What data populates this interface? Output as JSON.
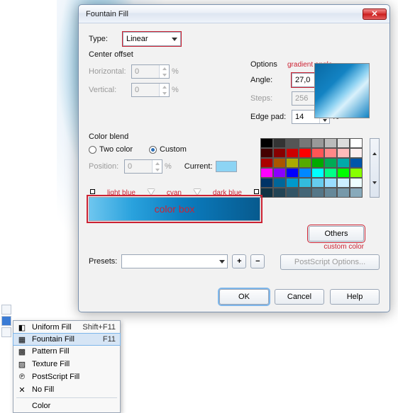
{
  "dialog": {
    "title": "Fountain Fill",
    "type_label": "Type:",
    "type_value": "Linear",
    "center_offset_label": "Center offset",
    "horizontal_label": "Horizontal:",
    "horizontal_value": "0",
    "vertical_label": "Vertical:",
    "vertical_value": "0",
    "options_label": "Options",
    "angle_label": "Angle:",
    "angle_value": "27,0",
    "steps_label": "Steps:",
    "steps_value": "256",
    "edgepad_label": "Edge pad:",
    "edgepad_value": "14",
    "percent": "%",
    "colorblend_label": "Color blend",
    "twocolor_label": "Two color",
    "custom_label": "Custom",
    "position_label": "Position:",
    "position_value": "0",
    "current_label": "Current:",
    "others_label": "Others",
    "presets_label": "Presets:",
    "postscript_label": "PostScript Options...",
    "ok": "OK",
    "cancel": "Cancel",
    "help": "Help"
  },
  "annotations": {
    "gradient_angle": "gradient angle",
    "light_blue": "light blue",
    "cyan": "cyan",
    "dark_blue": "dark blue",
    "color_box": "color box",
    "custom_color": "custom color"
  },
  "swatches": [
    [
      "#000",
      "#333",
      "#555",
      "#777",
      "#999",
      "#bbb",
      "#ddd",
      "#fff"
    ],
    [
      "#400",
      "#800",
      "#c00",
      "#f00",
      "#f55",
      "#f88",
      "#fbb",
      "#fee"
    ],
    [
      "#a00",
      "#a50",
      "#aa0",
      "#5a0",
      "#0a0",
      "#0a5",
      "#0aa",
      "#05a"
    ],
    [
      "#f0f",
      "#80f",
      "#00f",
      "#08f",
      "#0ff",
      "#0f8",
      "#0f0",
      "#8f0"
    ],
    [
      "#036",
      "#069",
      "#09c",
      "#3bd",
      "#6ce",
      "#9df",
      "#cef",
      "#eff"
    ],
    [
      "#134",
      "#245",
      "#356",
      "#467",
      "#578",
      "#689",
      "#79a",
      "#8ab"
    ]
  ],
  "context_menu": {
    "items": [
      {
        "label": "Uniform Fill",
        "shortcut": "Shift+F11",
        "icon": "uniform"
      },
      {
        "label": "Fountain Fill",
        "shortcut": "F11",
        "icon": "fountain",
        "selected": true
      },
      {
        "label": "Pattern Fill",
        "shortcut": "",
        "icon": "pattern"
      },
      {
        "label": "Texture Fill",
        "shortcut": "",
        "icon": "texture"
      },
      {
        "label": "PostScript Fill",
        "shortcut": "",
        "icon": "postscript"
      },
      {
        "label": "No Fill",
        "shortcut": "",
        "icon": "none"
      }
    ],
    "color_label": "Color"
  }
}
